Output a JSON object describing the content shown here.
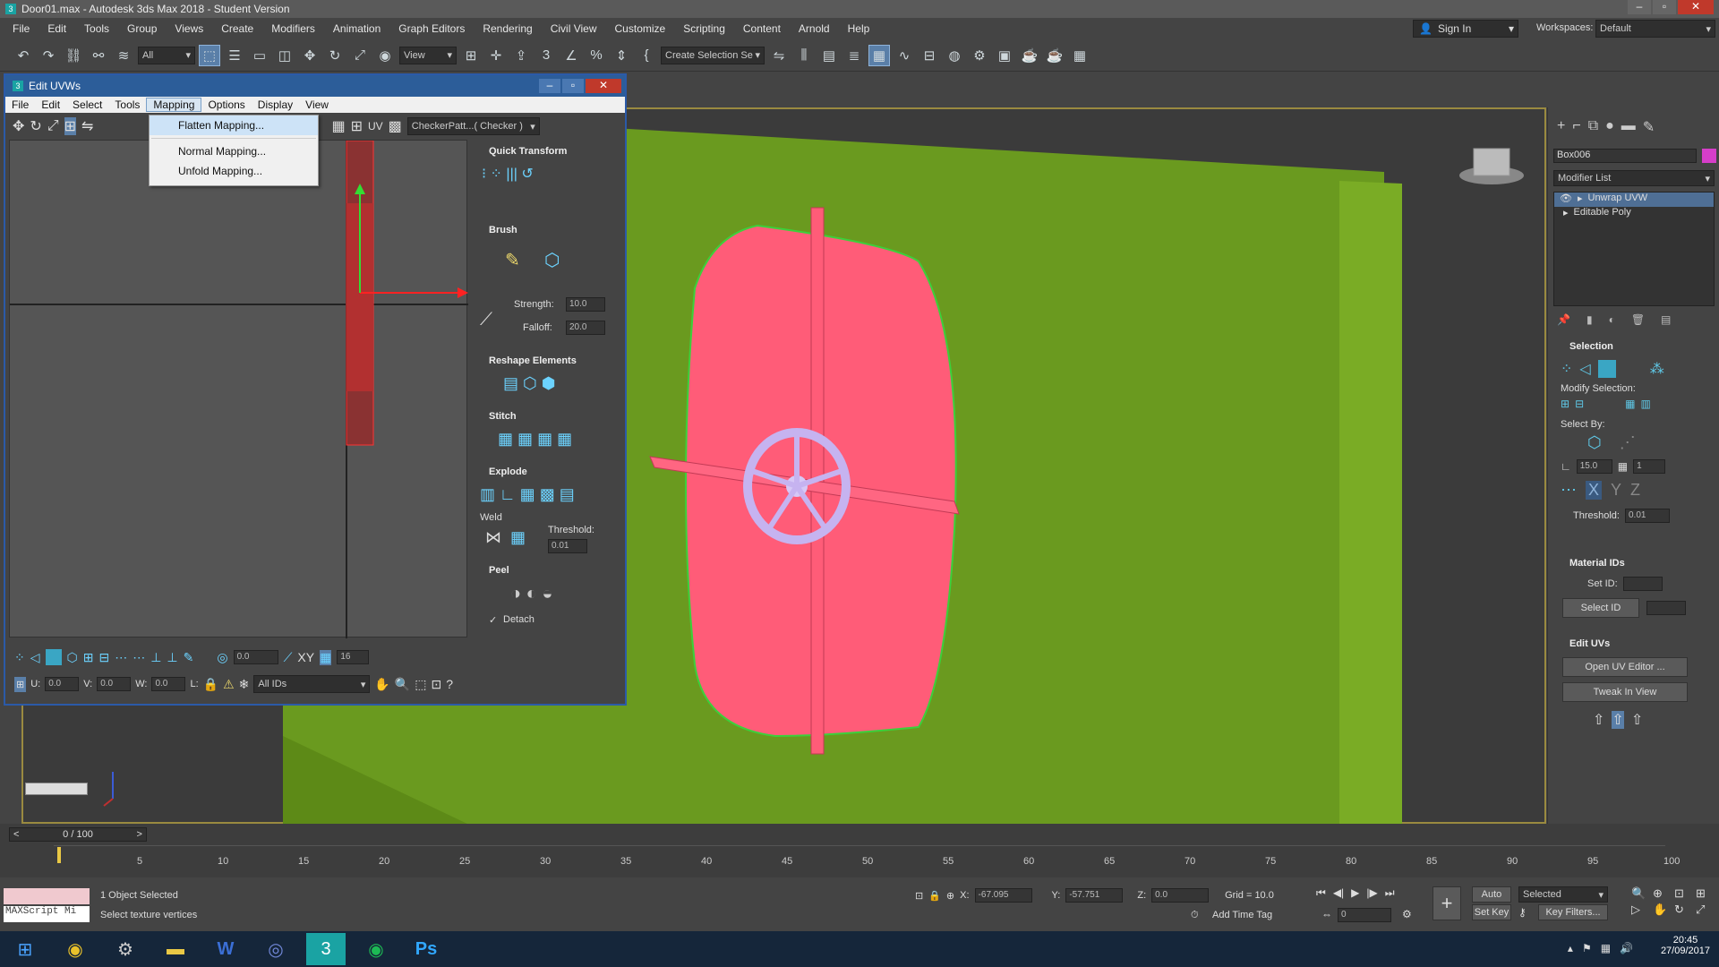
{
  "title": "Door01.max - Autodesk 3ds Max 2018 - Student Version",
  "menu": [
    "File",
    "Edit",
    "Tools",
    "Group",
    "Views",
    "Create",
    "Modifiers",
    "Animation",
    "Graph Editors",
    "Rendering",
    "Civil View",
    "Customize",
    "Scripting",
    "Content",
    "Arnold",
    "Help"
  ],
  "toolbar": {
    "filter": "All",
    "view": "View",
    "selection_set": "Create Selection Se"
  },
  "account": {
    "sign_in": "Sign In",
    "workspaces_label": "Workspaces:",
    "workspace": "Default"
  },
  "uv": {
    "title": "Edit UVWs",
    "menu": [
      "File",
      "Edit",
      "Select",
      "Tools",
      "Mapping",
      "Options",
      "Display",
      "View"
    ],
    "open_menu": "Mapping",
    "popup": [
      "Flatten Mapping...",
      "Normal Mapping...",
      "Unfold Mapping..."
    ],
    "uv_label": "UV",
    "checker": "CheckerPatt...( Checker )",
    "sections": {
      "quick": "Quick Transform",
      "brush": "Brush",
      "reshape": "Reshape Elements",
      "stitch": "Stitch",
      "explode": "Explode",
      "peel": "Peel"
    },
    "strength_label": "Strength:",
    "strength": "10.0",
    "falloff_label": "Falloff:",
    "falloff": "20.0",
    "weld": "Weld",
    "threshold_label": "Threshold:",
    "threshold": "0.01",
    "detach": "Detach",
    "bottom_angle": "0.0",
    "bottom_xy": "XY",
    "bottom_count": "16",
    "u_label": "U:",
    "u": "0.0",
    "v_label": "V:",
    "v": "0.0",
    "w_label": "W:",
    "w": "0.0",
    "l_label": "L:",
    "ids": "All IDs"
  },
  "right": {
    "object": "Box006",
    "modifier_list": "Modifier List",
    "stack": [
      "Unwrap UVW",
      "Editable Poly"
    ],
    "selection": "Selection",
    "modify_selection": "Modify Selection:",
    "select_by": "Select By:",
    "angle": "15.0",
    "count": "1",
    "x": "X",
    "y": "Y",
    "z": "Z",
    "threshold_label": "Threshold:",
    "threshold": "0.01",
    "material_ids": "Material IDs",
    "set_id": "Set ID:",
    "select_id": "Select ID",
    "edit_uvs": "Edit UVs",
    "open_uv_editor": "Open UV Editor ...",
    "tweak": "Tweak In View"
  },
  "timeline": {
    "frame": "0 / 100",
    "ticks": [
      "5",
      "10",
      "15",
      "20",
      "25",
      "30",
      "35",
      "40",
      "45",
      "50",
      "55",
      "60",
      "65",
      "70",
      "75",
      "80",
      "85",
      "90",
      "95",
      "100"
    ]
  },
  "status": {
    "maxscript": "MAXScript Mi",
    "selected": "1 Object Selected",
    "prompt": "Select texture vertices",
    "x_label": "X:",
    "x": "-67.095",
    "y_label": "Y:",
    "y": "-57.751",
    "z_label": "Z:",
    "z": "0.0",
    "grid": "Grid = 10.0",
    "add_time_tag": "Add Time Tag",
    "auto_key": "Auto Key",
    "key_mode": "Selected",
    "set_key": "Set Key",
    "key_filters": "Key Filters...",
    "frame": "0"
  },
  "clock": {
    "time": "20:45",
    "date": "27/09/2017"
  },
  "colors": {
    "wall": "#6a9a1f",
    "door": "#ff5c78",
    "wheel": "#b8a4e0",
    "accent": "#5a7fa8"
  }
}
